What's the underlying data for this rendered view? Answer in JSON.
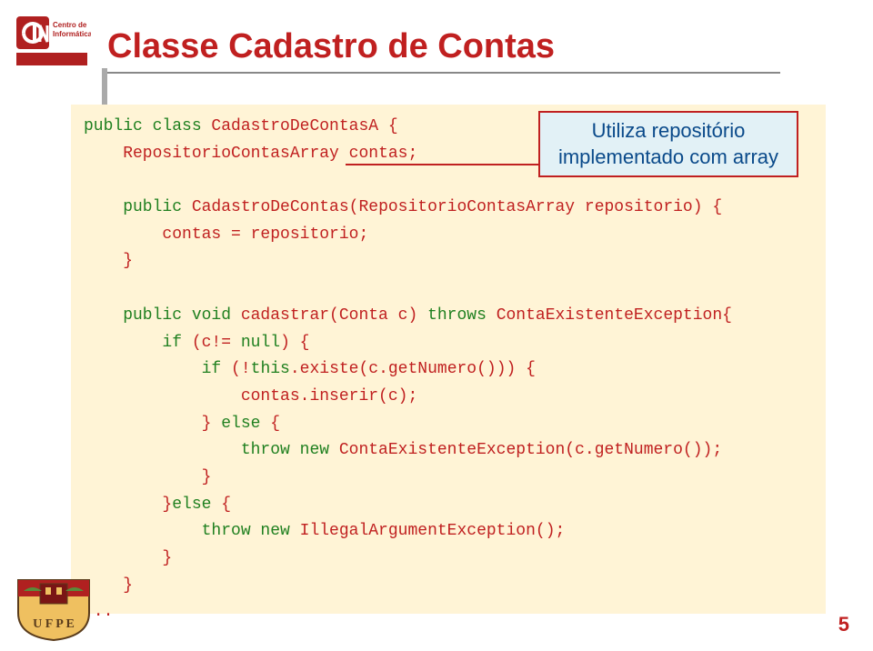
{
  "title": "Classe Cadastro de Contas",
  "annotation": {
    "line1": "Utiliza repositório",
    "line2": "implementado com array"
  },
  "code": {
    "l1a": "public",
    "l1b": " class",
    "l1c": " CadastroDeContasA {",
    "l2a": "    RepositorioContasArray",
    "l2b": " contas;",
    "l3": "",
    "l4a": "    public",
    "l4b": " CadastroDeContas(RepositorioContasArray repositorio) {",
    "l5": "        contas = repositorio;",
    "l6": "    }",
    "l7": "",
    "l8a": "    public void",
    "l8b": " cadastrar(Conta c)",
    "l8c": " throws",
    "l8d": " ContaExistenteException{",
    "l9a": "        if",
    "l9b": " (c!=",
    "l9c": " null",
    "l9d": ") {",
    "l10a": "            if",
    "l10b": " (!",
    "l10c": "this",
    "l10d": ".existe(c.getNumero())) {",
    "l11": "                contas.inserir(c);",
    "l12a": "            }",
    "l12b": " else",
    "l12c": " {",
    "l13a": "                throw new",
    "l13b": " ContaExistenteException(c.getNumero());",
    "l14": "            }",
    "l15a": "        }",
    "l15b": "else",
    "l15c": " {",
    "l16a": "            throw new",
    "l16b": " IllegalArgumentException();",
    "l17": "        }",
    "l18": "    }",
    "l19": "..."
  },
  "page_number": "5"
}
